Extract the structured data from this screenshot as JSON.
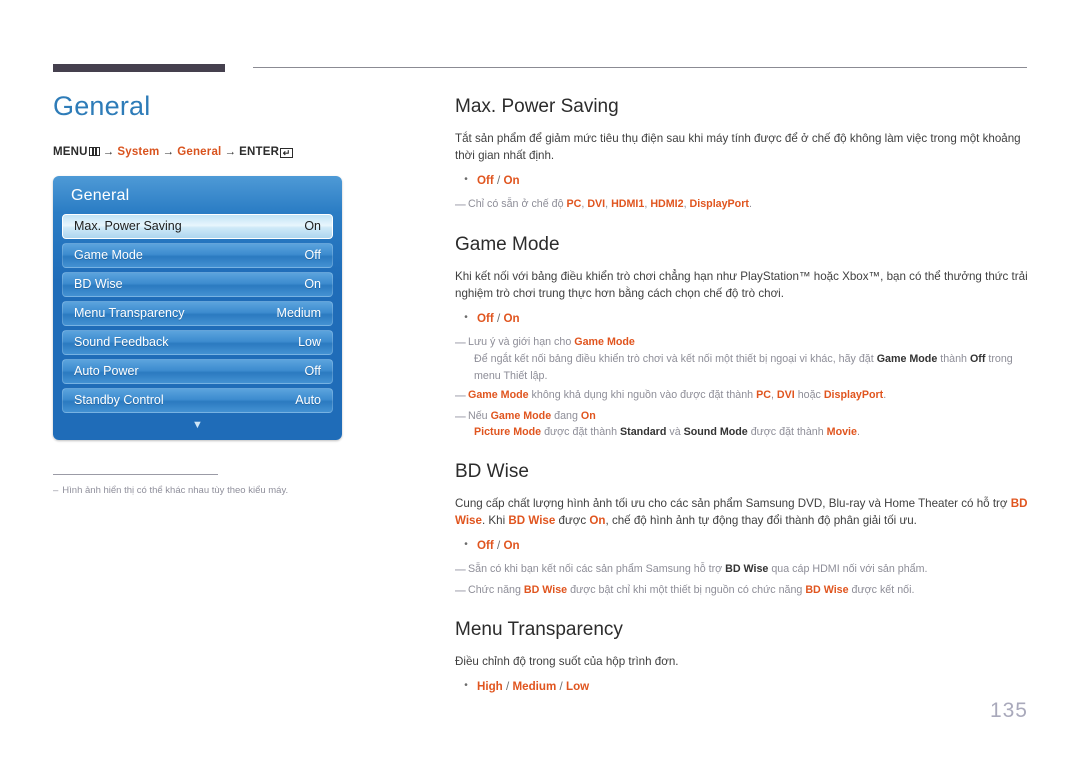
{
  "page": {
    "number": "135"
  },
  "left": {
    "title": "General",
    "breadcrumb": {
      "menu_label": "MENU",
      "menu_icon": "menu-grid-icon",
      "arrow": "→",
      "item1": "System",
      "item2": "General",
      "enter_label": "ENTER",
      "enter_icon": "enter-return-icon",
      "enter_glyph": "↵"
    },
    "osd": {
      "title": "General",
      "rows": [
        {
          "label": "Max. Power Saving",
          "value": "On",
          "selected": true
        },
        {
          "label": "Game Mode",
          "value": "Off",
          "selected": false
        },
        {
          "label": "BD Wise",
          "value": "On",
          "selected": false
        },
        {
          "label": "Menu Transparency",
          "value": "Medium",
          "selected": false
        },
        {
          "label": "Sound Feedback",
          "value": "Low",
          "selected": false
        },
        {
          "label": "Auto Power",
          "value": "Off",
          "selected": false
        },
        {
          "label": "Standby Control",
          "value": "Auto",
          "selected": false
        }
      ],
      "scroll_down_icon": "chevron-down-icon",
      "scroll_down_glyph": "▼"
    },
    "footnote": {
      "dash": "–",
      "text": "Hình ảnh hiển thị có thể khác nhau tùy theo kiểu máy."
    }
  },
  "sections": {
    "max_power_saving": {
      "title": "Max. Power Saving",
      "body": "Tắt sản phẩm để giảm mức tiêu thụ điện sau khi máy tính được để ở chế độ không làm việc trong một khoảng thời gian nhất định.",
      "options": {
        "a": "Off",
        "sep": "/",
        "b": "On"
      },
      "note1": {
        "pre": "Chỉ có sẵn ở chế độ ",
        "t1": "PC",
        "c1": ", ",
        "t2": "DVI",
        "c2": ", ",
        "t3": "HDMI1",
        "c3": ", ",
        "t4": "HDMI2",
        "c4": ", ",
        "t5": "DisplayPort",
        "post": "."
      }
    },
    "game_mode": {
      "title": "Game Mode",
      "body": "Khi kết nối với bảng điều khiển trò chơi chẳng hạn như PlayStation™ hoặc Xbox™, bạn có thể thưởng thức trải nghiệm trò chơi trung thực hơn bằng cách chọn chế độ trò chơi.",
      "options": {
        "a": "Off",
        "sep": "/",
        "b": "On"
      },
      "note1": {
        "pre": "Lưu ý và giới hạn cho ",
        "t1": "Game Mode",
        "line2_pre": "Để ngắt kết nối bảng điều khiển trò chơi và kết nối một thiết bị ngoại vi khác, hãy đặt ",
        "line2_t1": "Game Mode",
        "line2_mid": " thành ",
        "line2_t2": "Off",
        "line2_post": " trong menu Thiết lập."
      },
      "note2": {
        "t1": "Game Mode",
        "mid1": " không khả dụng khi nguồn vào được đặt thành ",
        "t2": "PC",
        "c2": ", ",
        "t3": "DVI",
        "mid2": " hoặc ",
        "t4": "DisplayPort",
        "post": "."
      },
      "note3": {
        "pre": "Nếu ",
        "t1": "Game Mode",
        "mid1": " đang ",
        "t2": "On",
        "line2_t1": "Picture Mode",
        "line2_mid1": " được đặt thành ",
        "line2_t2": "Standard",
        "line2_mid2": " và ",
        "line2_t3": "Sound Mode",
        "line2_mid3": " được đặt thành ",
        "line2_t4": "Movie",
        "line2_post": "."
      }
    },
    "bd_wise": {
      "title": "BD Wise",
      "body_pre": "Cung cấp chất lượng hình ảnh tối ưu cho các sản phẩm Samsung DVD, Blu-ray và Home Theater có hỗ trợ ",
      "body_t1": "BD Wise",
      "body_mid1": ". Khi ",
      "body_t2": "BD Wise",
      "body_mid2": " được ",
      "body_t3": "On",
      "body_post": ", chế độ hình ảnh tự động thay đổi thành độ phân giải tối ưu.",
      "options": {
        "a": "Off",
        "sep": "/",
        "b": "On"
      },
      "note1": {
        "pre": "Sẵn có khi bạn kết nối các sản phẩm Samsung hỗ trợ ",
        "t1": "BD Wise",
        "post": " qua cáp HDMI nối với sản phẩm."
      },
      "note2": {
        "pre": "Chức năng ",
        "t1": "BD Wise",
        "mid": " được bật chỉ khi một thiết bị nguồn có chức năng ",
        "t2": "BD Wise",
        "post": " được kết nối."
      }
    },
    "menu_transparency": {
      "title": "Menu Transparency",
      "body": "Điều chỉnh độ trong suốt của hộp trình đơn.",
      "options": {
        "a": "High",
        "sep1": "/",
        "b": "Medium",
        "sep2": "/",
        "c": "Low"
      }
    }
  },
  "colors": {
    "heading_blue": "#2e7cb8",
    "accent_orange": "#e0551f",
    "osd_blue": "#1f6cb8",
    "rule_dark": "#45404e",
    "note_gray": "#8e8e98",
    "page_number_gray": "#a9a9bb"
  },
  "icons": {
    "bullet": "•",
    "note_dash": "—"
  }
}
